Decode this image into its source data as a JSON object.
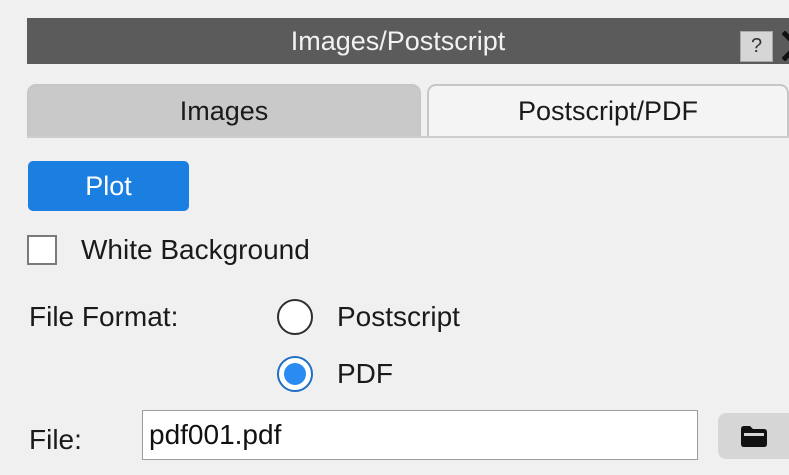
{
  "window": {
    "title": "Images/Postscript",
    "help_label": "?",
    "close_icon": "close-icon"
  },
  "tabs": [
    {
      "label": "Images",
      "active": false
    },
    {
      "label": "Postscript/PDF",
      "active": true
    }
  ],
  "panel": {
    "plot_label": "Plot",
    "plot_color": "#1a7fe0",
    "white_background": {
      "label": "White Background",
      "checked": false
    },
    "file_format": {
      "label": "File Format:",
      "options": [
        {
          "label": "Postscript",
          "selected": false
        },
        {
          "label": "PDF",
          "selected": true
        }
      ]
    },
    "file": {
      "label": "File:",
      "value": "pdf001.pdf",
      "browse_icon": "folder-icon"
    }
  }
}
